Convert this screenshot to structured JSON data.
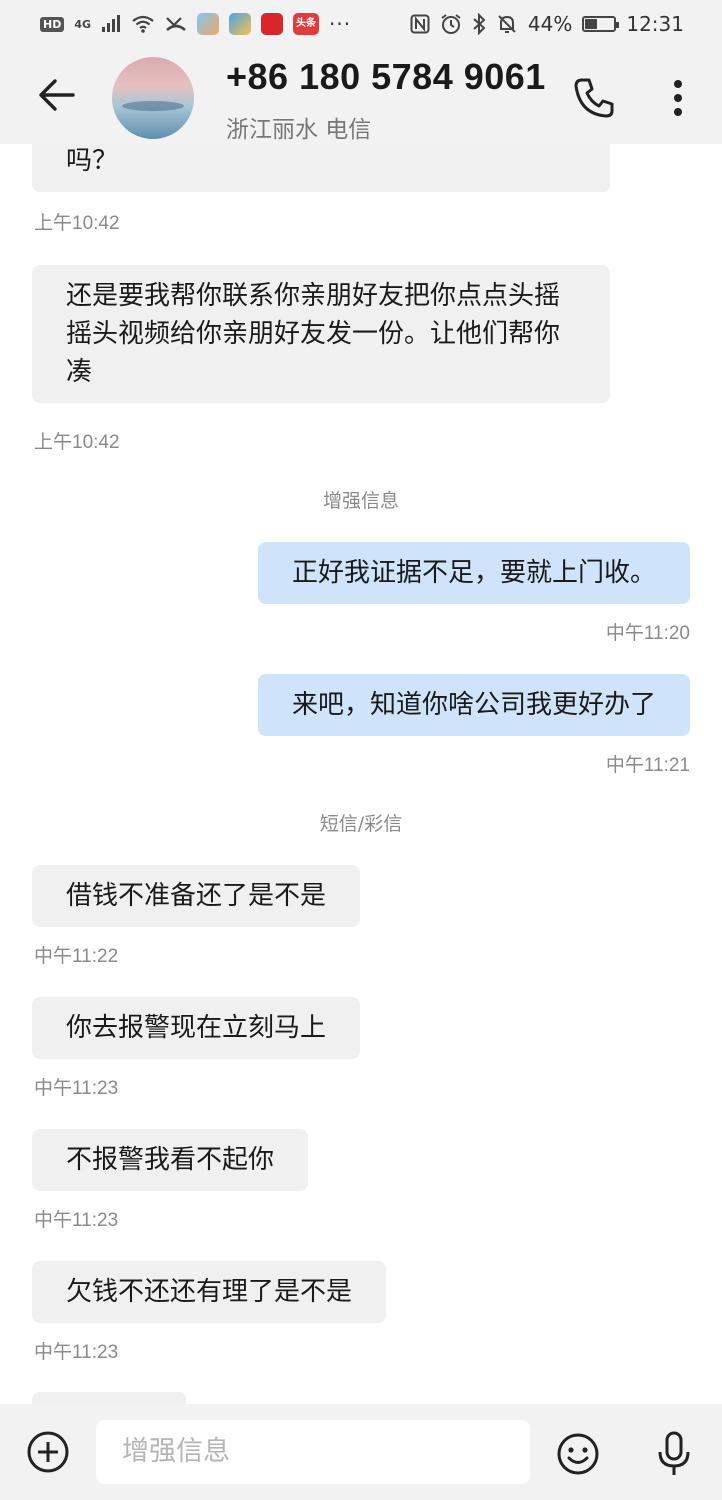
{
  "status_bar": {
    "hd": "HD",
    "network": "4G",
    "battery_percent": "44%",
    "battery_level": 0.44,
    "time": "12:31",
    "more": "···",
    "app_icon_labels": [
      "",
      "",
      "",
      "头条"
    ]
  },
  "header": {
    "phone_number": "+86 180 5784 9061",
    "location": "浙江丽水 电信",
    "back_icon": "arrow-left-icon",
    "call_icon": "phone-icon",
    "more_icon": "more-vertical-icon"
  },
  "messages": [
    {
      "type": "in",
      "text": "吗？"
    },
    {
      "type": "ts",
      "text": "上午10:42"
    },
    {
      "type": "in",
      "text": "还是要我帮你联系你亲朋好友把你点点头摇摇头视频给你亲朋好友发一份。让他们帮你凑"
    },
    {
      "type": "ts",
      "text": "上午10:42"
    },
    {
      "type": "divider",
      "text": "增强信息"
    },
    {
      "type": "out",
      "text": "正好我证据不足，要就上门收。"
    },
    {
      "type": "ts",
      "text": "中午11:20"
    },
    {
      "type": "out",
      "text": "来吧，知道你啥公司我更好办了"
    },
    {
      "type": "ts",
      "text": "中午11:21"
    },
    {
      "type": "divider",
      "text": "短信/彩信"
    },
    {
      "type": "in",
      "text": "借钱不准备还了是不是"
    },
    {
      "type": "ts",
      "text": "中午11:22"
    },
    {
      "type": "in",
      "text": "你去报警现在立刻马上"
    },
    {
      "type": "ts",
      "text": "中午11:23"
    },
    {
      "type": "in",
      "text": "不报警我看不起你"
    },
    {
      "type": "ts",
      "text": "中午11:23"
    },
    {
      "type": "in",
      "text": "欠钱不还还有理了是不是"
    },
    {
      "type": "ts",
      "text": "中午11:23"
    }
  ],
  "compose": {
    "placeholder": "增强信息",
    "add_icon": "add-circle-icon",
    "emoji_icon": "emoji-icon",
    "mic_icon": "microphone-icon"
  },
  "colors": {
    "incoming_bubble": "#f0f0f0",
    "outgoing_bubble": "#cfe4fb",
    "bar_background": "#f2f2f2",
    "timestamp": "#8a8a8a"
  }
}
